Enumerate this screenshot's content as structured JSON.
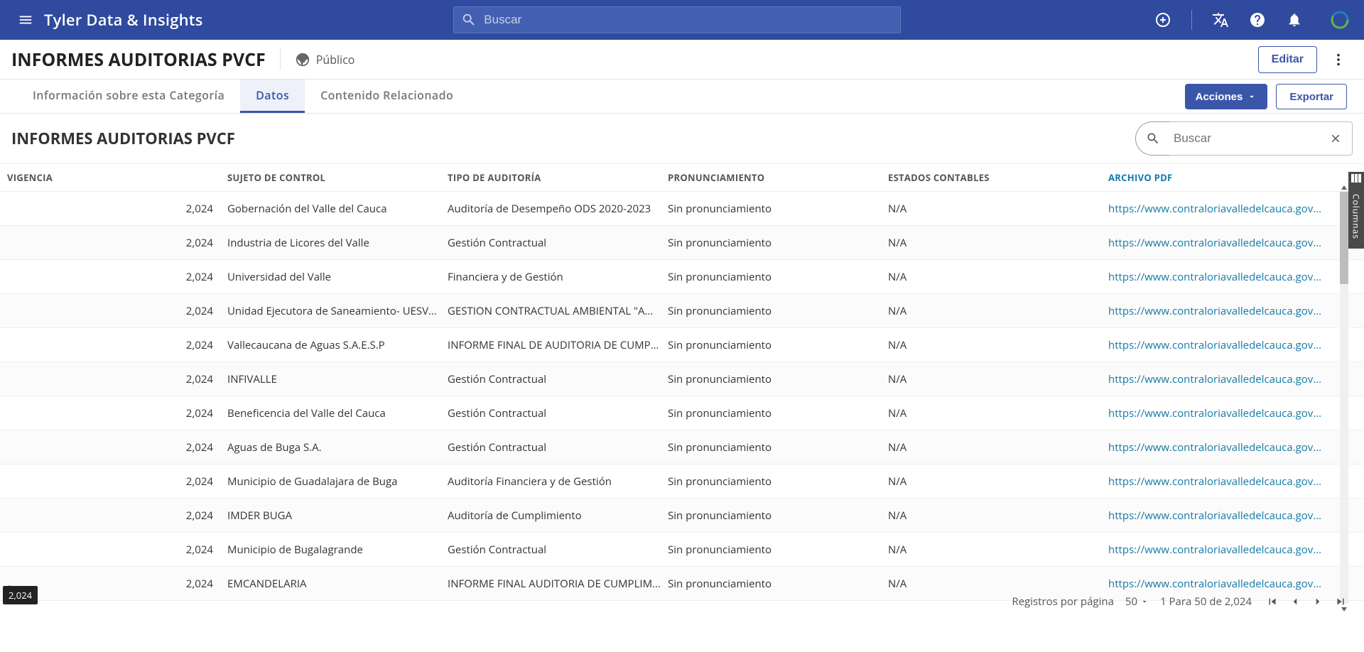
{
  "brand": "Tyler Data & Insights",
  "search_ph": "Buscar",
  "page_title": "INFORMES AUDITORIAS PVCF",
  "visibility": "Público",
  "edit_btn": "Editar",
  "tabs": {
    "info": "Información sobre esta Categoría",
    "data": "Datos",
    "related": "Contenido Relacionado"
  },
  "actions_btn": "Acciones",
  "export_btn": "Exportar",
  "subtitle": "INFORMES AUDITORIAS PVCF",
  "tbl_search_ph": "Buscar",
  "col_tab": "Columnas",
  "tooltip": "2,024",
  "pager": {
    "rpp_label": "Registros por página",
    "rpp_value": "50",
    "range": "1 Para 50 de 2,024"
  },
  "cols": {
    "vig": "VIGENCIA",
    "suj": "SUJETO DE CONTROL",
    "tip": "TIPO DE AUDITORÍA",
    "pro": "PRONUNCIAMIENTO",
    "est": "ESTADOS CONTABLES",
    "arc": "ARCHIVO PDF"
  },
  "link_text": "https://www.contraloriavalledelcauca.gov.co/desc",
  "rows": [
    {
      "vig": "2,024",
      "suj": "Gobernación del Valle del Cauca",
      "tip": "Auditoría de Desempeño ODS 2020-2023",
      "pro": "Sin pronunciamiento",
      "est": "N/A"
    },
    {
      "vig": "2,024",
      "suj": "Industria de Licores del Valle",
      "tip": "Gestión Contractual",
      "pro": "Sin pronunciamiento",
      "est": "N/A"
    },
    {
      "vig": "2,024",
      "suj": "Universidad del Valle",
      "tip": "Financiera y de Gestión",
      "pro": "Sin pronunciamiento",
      "est": "N/A"
    },
    {
      "vig": "2,024",
      "suj": "Unidad Ejecutora de Saneamiento- UESVALLE",
      "tip": "GESTION CONTRACTUAL AMBIENTAL \"AGUA PARA",
      "pro": "Sin pronunciamiento",
      "est": "N/A"
    },
    {
      "vig": "2,024",
      "suj": "Vallecaucana de Aguas S.A.E.S.P",
      "tip": "INFORME FINAL DE AUDITORIA DE CUMPLIMIENT(",
      "pro": "Sin pronunciamiento",
      "est": "N/A"
    },
    {
      "vig": "2,024",
      "suj": "INFIVALLE",
      "tip": "Gestión Contractual",
      "pro": "Sin pronunciamiento",
      "est": "N/A"
    },
    {
      "vig": "2,024",
      "suj": "Beneficencia del Valle del Cauca",
      "tip": "Gestión Contractual",
      "pro": "Sin pronunciamiento",
      "est": "N/A"
    },
    {
      "vig": "2,024",
      "suj": "Aguas de Buga S.A.",
      "tip": "Gestión Contractual",
      "pro": "Sin pronunciamiento",
      "est": "N/A"
    },
    {
      "vig": "2,024",
      "suj": "Municipio de Guadalajara de Buga",
      "tip": "Auditoría Financiera y de Gestión",
      "pro": "Sin pronunciamiento",
      "est": "N/A"
    },
    {
      "vig": "2,024",
      "suj": "IMDER BUGA",
      "tip": "Auditoría de Cumplimiento",
      "pro": "Sin pronunciamiento",
      "est": "N/A"
    },
    {
      "vig": "2,024",
      "suj": "Municipio de Bugalagrande",
      "tip": "Gestión Contractual",
      "pro": "Sin pronunciamiento",
      "est": "N/A"
    },
    {
      "vig": "2,024",
      "suj": "EMCANDELARIA",
      "tip": "INFORME FINAL AUDITORIA DE CUMPLIMIENTO G",
      "pro": "Sin pronunciamiento",
      "est": "N/A"
    }
  ]
}
